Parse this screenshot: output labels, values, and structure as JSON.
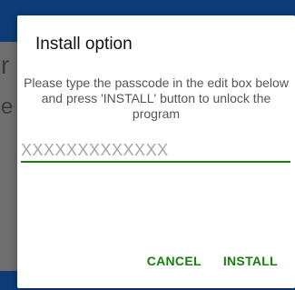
{
  "dialog": {
    "title": "Install option",
    "message": "Please type the passcode in the edit box below and press 'INSTALL' button to unlock the program",
    "input": {
      "placeholder": "XXXXXXXXXXXXX",
      "value": ""
    },
    "buttons": {
      "cancel": "CANCEL",
      "install": "INSTALL"
    }
  },
  "background": {
    "glyph_1": "r",
    "glyph_2": "e"
  },
  "colors": {
    "accent": "#1a7d10",
    "header": "#0d3c78",
    "scrim": "#6f6f6f",
    "dialog_bg": "#ffffff"
  }
}
